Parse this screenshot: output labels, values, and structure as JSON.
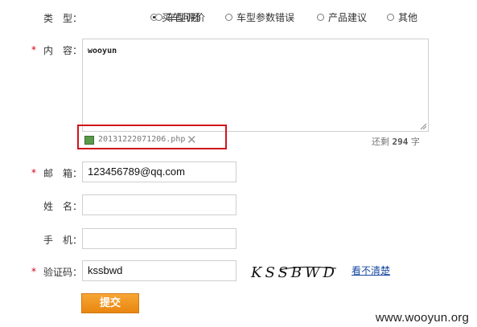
{
  "type_field": {
    "label": "类　型：",
    "options": [
      {
        "label": "买车问题",
        "selected": true
      },
      {
        "label": "车型评价",
        "selected": false
      },
      {
        "label": "车型参数错误",
        "selected": false
      },
      {
        "label": "产品建议",
        "selected": false
      },
      {
        "label": "其他",
        "selected": false
      }
    ]
  },
  "content_field": {
    "required_mark": "*",
    "label": "内　容：",
    "value": "wooyun",
    "attachment_name": "20131222071206.php",
    "remove_glyph": "✕",
    "counter_prefix": "还剩",
    "counter_value": "294",
    "counter_suffix": "字"
  },
  "email_field": {
    "required_mark": "*",
    "label": "邮　箱：",
    "value": "123456789@qq.com"
  },
  "name_field": {
    "label": "姓　名：",
    "value": ""
  },
  "phone_field": {
    "label": "手　机：",
    "value": ""
  },
  "captcha_field": {
    "required_mark": "*",
    "label": "验证码：",
    "value": "kssbwd",
    "captcha_text": "KSSBWD",
    "refresh_link": "看不清楚"
  },
  "submit_label": "提交",
  "watermark": "www.wooyun.org",
  "colors": {
    "required": "#d0021b",
    "highlight": "#d0151a",
    "button": "#f0961f",
    "link": "#1a4aa0"
  }
}
